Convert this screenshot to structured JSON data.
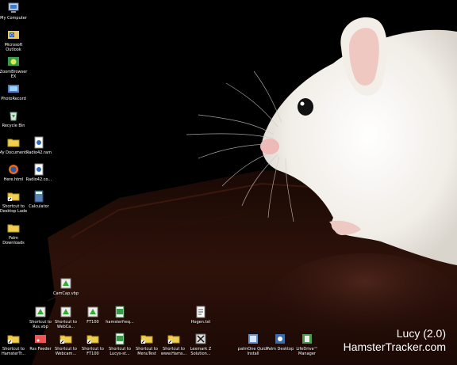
{
  "desktop_icons": [
    {
      "label": "My Computer",
      "icon": "computer-icon"
    },
    {
      "label": "Microsoft Outlook",
      "icon": "outlook-icon"
    },
    {
      "label": "ZoomBrowser EX",
      "icon": "zoombrowser-icon"
    },
    {
      "label": "PhotoRecord",
      "icon": "photorecord-icon"
    },
    {
      "label": "Recycle Bin",
      "icon": "recycle-bin-icon"
    },
    {
      "label": "My Documents",
      "icon": "folder-icon"
    },
    {
      "label": "Radio42.ram",
      "icon": "media-file-icon"
    },
    {
      "label": "Here.html",
      "icon": "firefox-icon"
    },
    {
      "label": "Radio42.co...",
      "icon": "media-file-icon"
    },
    {
      "label": "Shortcut to Desktop Lade",
      "icon": "folder-shortcut-icon"
    },
    {
      "label": "Calculator",
      "icon": "calculator-icon"
    },
    {
      "label": "Palm Downloads",
      "icon": "folder-icon"
    },
    {
      "label": "CamCap.vbp",
      "icon": "vb-project-icon"
    },
    {
      "label": "Shortcut to Rss.vbp",
      "icon": "vb-project-icon"
    },
    {
      "label": "Shortcut to WebCa...",
      "icon": "vb-project-icon"
    },
    {
      "label": "FT100",
      "icon": "vb-project-icon"
    },
    {
      "label": "hamsterfreq...",
      "icon": "excel-file-icon"
    },
    {
      "label": "Hogen.txt",
      "icon": "text-file-icon"
    },
    {
      "label": "Shortcut to HamsterTr...",
      "icon": "folder-shortcut-icon"
    },
    {
      "label": "Rss Feeder",
      "icon": "rss-feeder-icon"
    },
    {
      "label": "Shortcut to Webcam...",
      "icon": "folder-shortcut-icon"
    },
    {
      "label": "Shortcut to FT100",
      "icon": "folder-shortcut-icon"
    },
    {
      "label": "Shortcut to Lucys-st...",
      "icon": "excel-file-icon"
    },
    {
      "label": "Shortcut to MenuTest",
      "icon": "folder-shortcut-icon"
    },
    {
      "label": "Shortcut to www.Hams...",
      "icon": "folder-shortcut-icon"
    },
    {
      "label": "Lexmark Z Solution...",
      "icon": "lexmark-icon"
    },
    {
      "label": "palmOne Quick Install",
      "icon": "palm-install-icon"
    },
    {
      "label": "Palm Desktop",
      "icon": "palm-desktop-icon"
    },
    {
      "label": "LifeDrive™ Manager",
      "icon": "lifedrive-icon"
    }
  ],
  "watermark": {
    "title": "Lucy (2.0)",
    "site": "HamsterTracker.com"
  },
  "colors": {
    "background": "#000000",
    "table": "#2a0f08",
    "hamster": "#f3efea",
    "ear_inner": "#f0c7c2",
    "label_text": "#ffffff"
  }
}
